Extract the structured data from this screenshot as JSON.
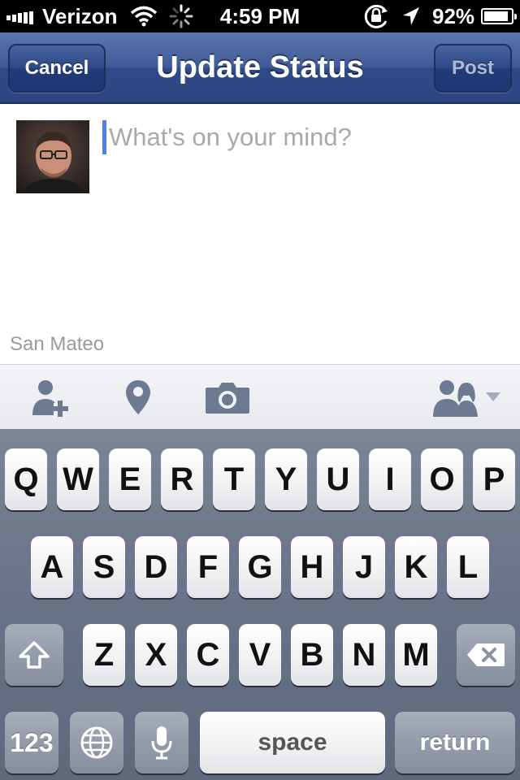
{
  "status_bar": {
    "carrier": "Verizon",
    "time": "4:59 PM",
    "battery_percent": "92%",
    "battery_level": 0.92,
    "icons": [
      "signal-bars-icon",
      "wifi-icon",
      "activity-spinner-icon",
      "orientation-lock-icon",
      "location-arrow-icon",
      "battery-icon"
    ]
  },
  "nav": {
    "title": "Update Status",
    "cancel_label": "Cancel",
    "post_label": "Post"
  },
  "composer": {
    "placeholder": "What's on your mind?",
    "value": "",
    "location": "San Mateo"
  },
  "toolbar": {
    "icons": [
      "tag-friends-icon",
      "location-pin-icon",
      "camera-icon",
      "audience-icon"
    ]
  },
  "keyboard": {
    "row1": [
      "Q",
      "W",
      "E",
      "R",
      "T",
      "Y",
      "U",
      "I",
      "O",
      "P"
    ],
    "row2": [
      "A",
      "S",
      "D",
      "F",
      "G",
      "H",
      "J",
      "K",
      "L"
    ],
    "row3": [
      "Z",
      "X",
      "C",
      "V",
      "B",
      "N",
      "M"
    ],
    "numbers_label": "123",
    "space_label": "space",
    "return_label": "return"
  },
  "colors": {
    "nav_blue": "#3f5a97",
    "caret": "#4d7fe4",
    "placeholder": "#a9a9a9"
  }
}
